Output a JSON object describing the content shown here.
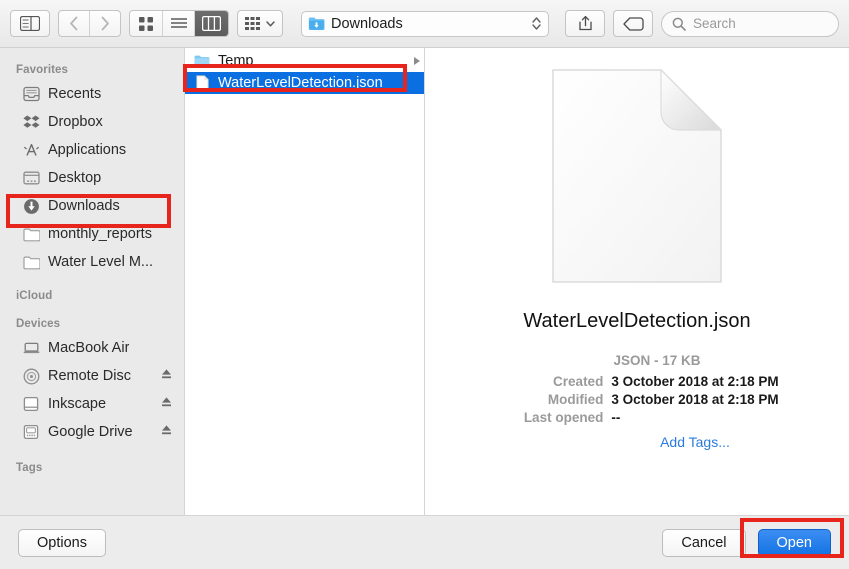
{
  "toolbar": {
    "sidebar_toggle": "sidebar-toggle",
    "back": "back",
    "forward": "forward",
    "view_icon": "icon-view",
    "view_list": "list-view",
    "view_column": "column-view",
    "arrange": "arrange",
    "path_label": "Downloads",
    "share": "share",
    "tag": "tag",
    "search_placeholder": "Search"
  },
  "sidebar": {
    "sections": [
      {
        "title": "Favorites",
        "items": [
          {
            "label": "Recents",
            "icon": "recents-icon"
          },
          {
            "label": "Dropbox",
            "icon": "dropbox-icon"
          },
          {
            "label": "Applications",
            "icon": "applications-icon"
          },
          {
            "label": "Desktop",
            "icon": "desktop-icon"
          },
          {
            "label": "Downloads",
            "icon": "downloads-icon",
            "highlighted": true
          },
          {
            "label": "monthly_reports",
            "icon": "folder-icon"
          },
          {
            "label": "Water Level M...",
            "icon": "folder-icon"
          }
        ]
      },
      {
        "title": "iCloud",
        "items": []
      },
      {
        "title": "Devices",
        "items": [
          {
            "label": "MacBook Air",
            "icon": "laptop-icon"
          },
          {
            "label": "Remote Disc",
            "icon": "disc-icon"
          },
          {
            "label": "Inkscape",
            "icon": "drive-icon",
            "eject": true
          },
          {
            "label": "Google Drive",
            "icon": "external-drive-icon",
            "eject": true
          }
        ]
      },
      {
        "title": "Tags",
        "items": []
      }
    ]
  },
  "filelist": {
    "rows": [
      {
        "name": "Temp",
        "icon": "folder-icon",
        "selected": false,
        "has_disclosure": true
      },
      {
        "name": "WaterLevelDetection.json",
        "icon": "document-icon",
        "selected": true,
        "has_disclosure": false
      }
    ]
  },
  "preview": {
    "icon": "document-icon",
    "filename": "WaterLevelDetection.json",
    "kind_and_size": "JSON - 17 KB",
    "fields": [
      {
        "key": "Created",
        "value": "3 October 2018 at 2:18 PM"
      },
      {
        "key": "Modified",
        "value": "3 October 2018 at 2:18 PM"
      },
      {
        "key": "Last opened",
        "value": "--"
      }
    ],
    "add_tags": "Add Tags..."
  },
  "footer": {
    "options": "Options",
    "cancel": "Cancel",
    "open": "Open"
  },
  "colors": {
    "selection_blue": "#0a6fe0",
    "annotation_red": "#e8251c",
    "link_blue": "#2a7bdc",
    "primary_button_blue": "#1272e3"
  }
}
